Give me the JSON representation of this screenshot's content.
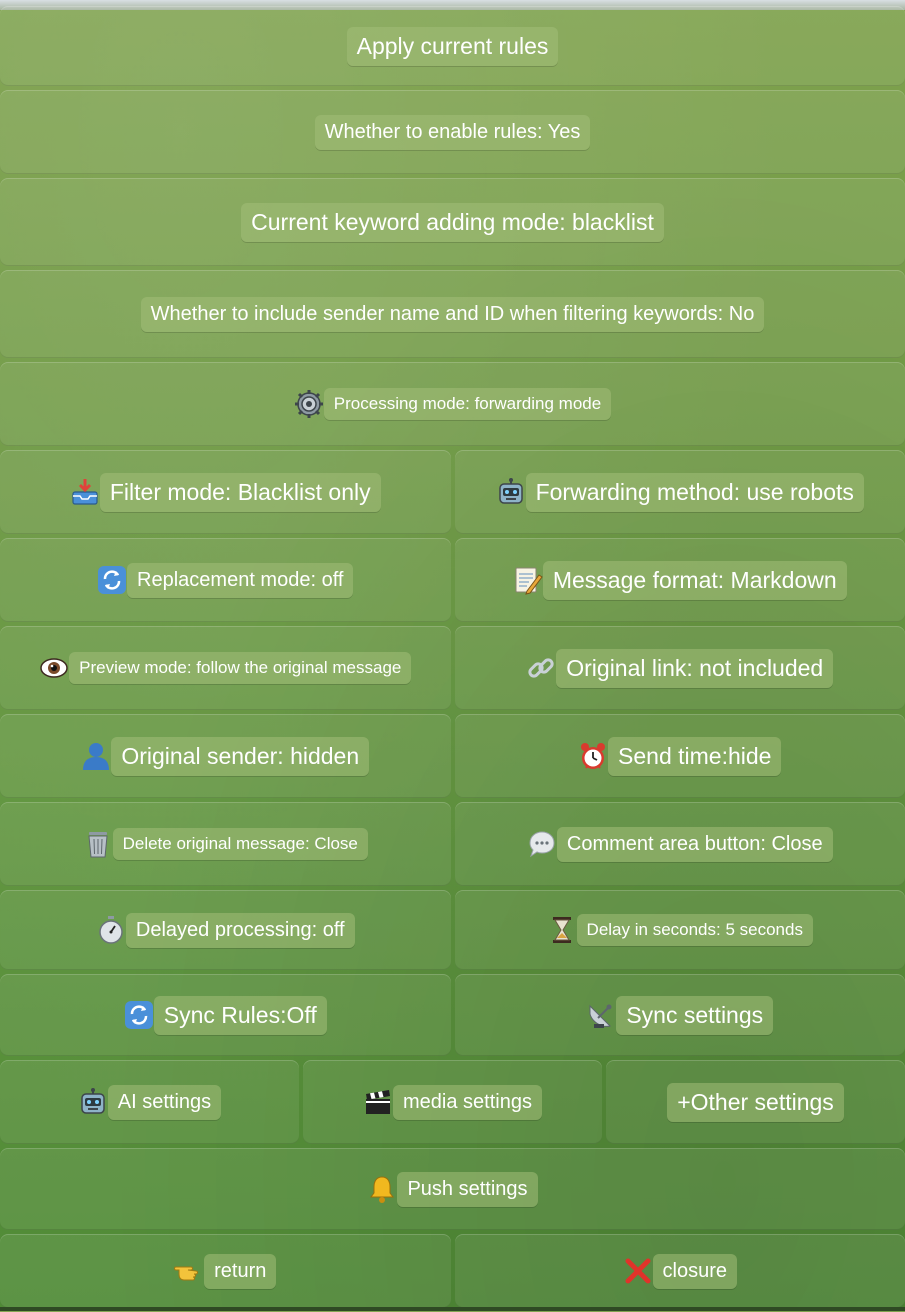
{
  "buttons": {
    "apply_rules": "Apply current rules",
    "enable_rules": "Whether to enable rules: Yes",
    "keyword_mode": "Current keyword adding mode: blacklist",
    "include_sender": "Whether to include sender name and ID when filtering keywords: No",
    "processing_mode": "Processing mode: forwarding mode",
    "filter_mode": "Filter mode: Blacklist only",
    "forwarding_method": "Forwarding method: use robots",
    "replacement_mode": "Replacement mode: off",
    "message_format": "Message format: Markdown",
    "preview_mode": "Preview mode: follow the original message",
    "original_link": "Original link: not included",
    "original_sender": "Original sender: hidden",
    "send_time": "Send time:hide",
    "delete_original": "Delete original message: Close",
    "comment_button": "Comment area button: Close",
    "delayed_processing": "Delayed processing: off",
    "delay_seconds": "Delay in seconds: 5 seconds",
    "sync_rules": "Sync Rules:Off",
    "sync_settings": "Sync settings",
    "ai_settings": "AI settings",
    "media_settings": "media settings",
    "other_settings": "+Other settings",
    "push_settings": "Push settings",
    "return": "return",
    "closure": "closure"
  },
  "icons": {
    "processing_mode": "gear-icon",
    "filter_mode": "inbox-tray-icon",
    "forwarding_method": "robot-icon",
    "replacement_mode": "refresh-icon",
    "message_format": "memo-icon",
    "preview_mode": "eye-icon",
    "original_link": "link-icon",
    "original_sender": "user-silhouette-icon",
    "send_time": "alarm-clock-icon",
    "delete_original": "wastebasket-icon",
    "comment_button": "speech-bubble-icon",
    "delayed_processing": "stopwatch-icon",
    "delay_seconds": "hourglass-icon",
    "sync_rules": "refresh-icon",
    "sync_settings": "satellite-dish-icon",
    "ai_settings": "robot-icon",
    "media_settings": "clapper-board-icon",
    "push_settings": "bell-icon",
    "return": "pointing-hand-icon",
    "closure": "cross-mark-icon"
  },
  "colors": {
    "background_top": "#7fa24e",
    "background_bottom": "#4f8a36",
    "pill": "#a3bd78",
    "text": "#ffffff"
  }
}
